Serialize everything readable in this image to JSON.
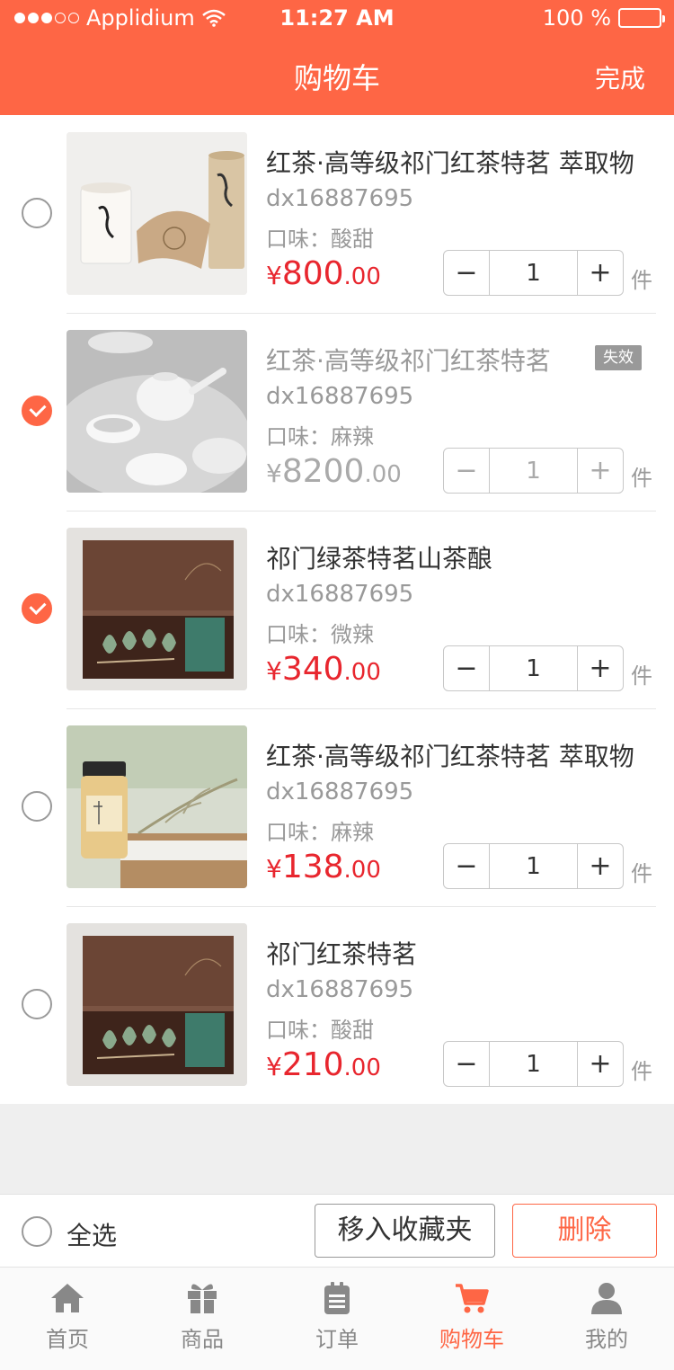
{
  "status_bar": {
    "carrier": "Applidium",
    "time": "11:27 AM",
    "battery": "100 %"
  },
  "nav": {
    "title": "购物车",
    "done_label": "完成"
  },
  "items": [
    {
      "title": "红茶·高等级祁门红茶特茗 萃取物",
      "code": "dx16887695",
      "flavor": "口味：酸甜",
      "price_currency": "¥",
      "price_int": "800",
      "price_dec": ".00",
      "quantity": "1",
      "unit": "件",
      "checked": false,
      "invalid": false
    },
    {
      "title": "红茶·高等级祁门红茶特茗",
      "badge": "失效",
      "code": "dx16887695",
      "flavor": "口味：麻辣",
      "price_currency": "¥",
      "price_int": "8200",
      "price_dec": ".00",
      "quantity": "1",
      "unit": "件",
      "checked": true,
      "invalid": true
    },
    {
      "title": "祁门绿茶特茗山茶酿",
      "code": "dx16887695",
      "flavor": "口味：微辣",
      "price_currency": "¥",
      "price_int": "340",
      "price_dec": ".00",
      "quantity": "1",
      "unit": "件",
      "checked": true,
      "invalid": false
    },
    {
      "title": "红茶·高等级祁门红茶特茗 萃取物",
      "code": "dx16887695",
      "flavor": "口味：麻辣",
      "price_currency": "¥",
      "price_int": "138",
      "price_dec": ".00",
      "quantity": "1",
      "unit": "件",
      "checked": false,
      "invalid": false
    },
    {
      "title": "祁门红茶特茗",
      "code": "dx16887695",
      "flavor": "口味：酸甜",
      "price_currency": "¥",
      "price_int": "210",
      "price_dec": ".00",
      "quantity": "1",
      "unit": "件",
      "checked": false,
      "invalid": false
    }
  ],
  "stepper": {
    "minus": "−",
    "plus": "+"
  },
  "actions": {
    "select_all": "全选",
    "move_to_favorites": "移入收藏夹",
    "delete": "删除"
  },
  "tabs": [
    {
      "label": "首页",
      "icon": "home-icon",
      "active": false
    },
    {
      "label": "商品",
      "icon": "gift-icon",
      "active": false
    },
    {
      "label": "订单",
      "icon": "clipboard-icon",
      "active": false
    },
    {
      "label": "购物车",
      "icon": "cart-icon",
      "active": true
    },
    {
      "label": "我的",
      "icon": "user-icon",
      "active": false
    }
  ],
  "colors": {
    "accent": "#fe6645",
    "price": "#e8262e"
  }
}
